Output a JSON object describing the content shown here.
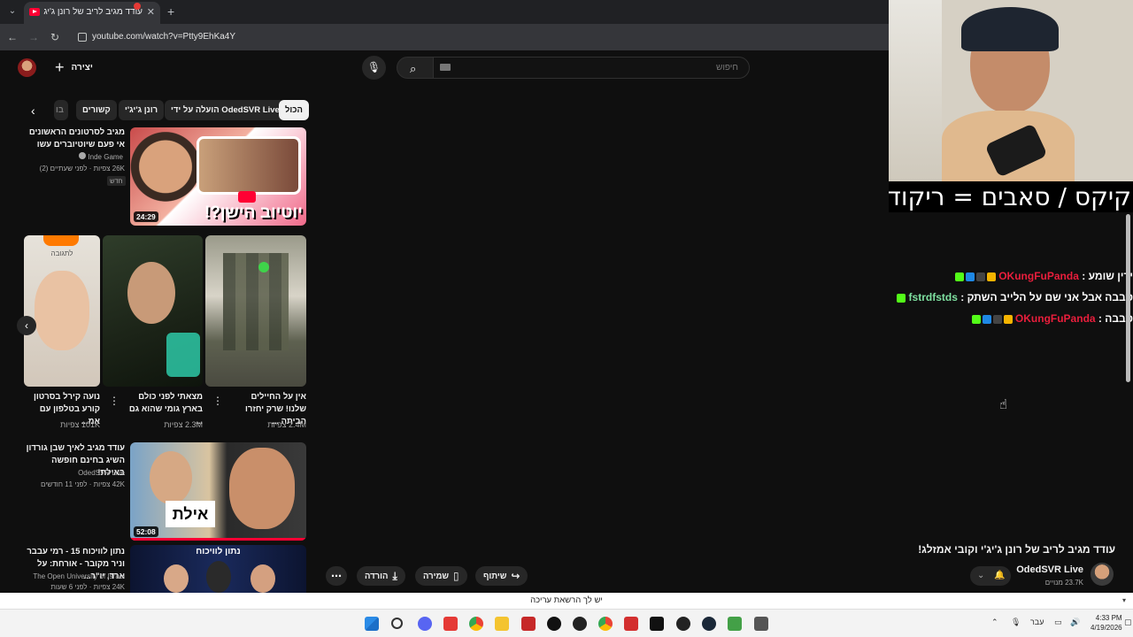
{
  "browser": {
    "tab_title": "עודד מגיב לריב של רונן ג'יג'י וקובי",
    "url": "youtube.com/watch?v=Ptty9EhKa4Y"
  },
  "masthead": {
    "create_label": "יצירה",
    "search_placeholder": "חיפוש"
  },
  "chips": [
    "הכול",
    "הועלה על ידי OdedSVR Live",
    "רונן ג'יג'י",
    "קשורים",
    "בו"
  ],
  "related": [
    {
      "title": "מגיב לסרטונים הראשונים אי פעם שיוטיוברים עשו",
      "channel": "Inde Game",
      "meta": "26K צפיות · לפני שעתיים (2)",
      "badge": "חדש",
      "duration": "24:29",
      "thumb_text": "יוטיוב הישן?!"
    },
    {
      "title": "עודד מגיב לאיך שבן גורדון השיג בחינם חופשה באילת!",
      "channel": "OdedSVR Live",
      "meta": "42K צפיות · לפני 11 חודשים",
      "duration": "52:08",
      "thumb_text": "אילת"
    },
    {
      "title": "נתון לוויכוח 15 - רמי עבבר וניר מקובר - אורחת: על ארד, יו\"ר...",
      "channel": "The Open University of Israel",
      "meta": "24K צפיות · לפני 6 שעות",
      "thumb_text": "נתון לוויכוח"
    }
  ],
  "shorts": [
    {
      "title": "אין על החיילים שלנו! שרק יחזרו הביתה ...",
      "views": "2.4M צפיות"
    },
    {
      "title": "מצאתי לפני כולם בארץ גומי שהוא גם ...",
      "views": "2.3M צפיות"
    },
    {
      "title": "נועה קירל בסרטון קורע בטלפון עם אמ...",
      "views": "101K צפיות",
      "label": "לתגובה"
    }
  ],
  "actions": {
    "share": "שיתוף",
    "save": "שמירה",
    "download": "הורדה"
  },
  "overlay": {
    "caption": "קיקס / סאבים = ריקוד",
    "chat": [
      {
        "user": "OKungFuPanda",
        "user_color": "#e91e3c",
        "message": "ירין שומע"
      },
      {
        "user": "fstrdfstds",
        "user_color": "#7ee0a0",
        "message": "סבבה אבל אני שם על הלייב השתק"
      },
      {
        "user": "OKungFuPanda",
        "user_color": "#e91e3c",
        "message": "סבבה"
      }
    ]
  },
  "video": {
    "title": "עודד מגיב לריב של רונן ג'יג'י וקובי אמזלג!",
    "channel": "OdedSVR Live",
    "subscribers": "23.7K מנויים"
  },
  "download_bar": "יש לך הרשאת עריכה",
  "system": {
    "language": "עבר",
    "time": "4:33 PM",
    "date": "4/19/2026"
  },
  "colors": {
    "youtube_red": "#ff0033",
    "kick_green": "#53fc18"
  }
}
